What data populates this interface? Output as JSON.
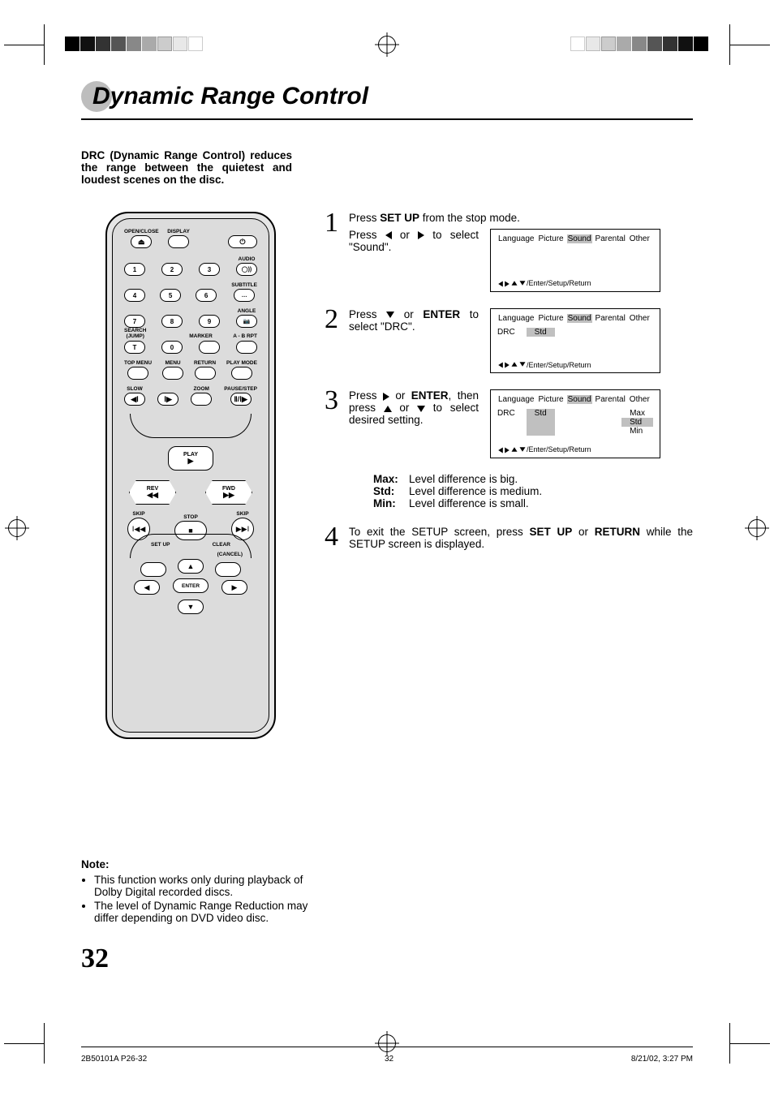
{
  "title": "Dynamic Range Control",
  "intro": "DRC (Dynamic Range Control) reduces the range between the quietest and loudest scenes on the disc.",
  "steps": {
    "s1": {
      "line1_pre": "Press ",
      "line1_bold": "SET UP",
      "line1_post": " from the stop mode.",
      "line2": "Press ◀ or ▶ to select \"Sound\"."
    },
    "s2": {
      "text_pre": "Press ▼ or ",
      "text_bold": "ENTER",
      "text_post": " to select \"DRC\"."
    },
    "s3": {
      "text_pre": "Press ▶ or ",
      "text_bold": "ENTER",
      "text_post": ", then press ▲ or ▼ to select desired setting."
    },
    "s4": {
      "text_pre": "To exit the SETUP screen, press ",
      "b1": "SET UP",
      "mid": " or ",
      "b2": "RETURN",
      "text_post": " while the SETUP screen is displayed."
    }
  },
  "osd": {
    "tabs": [
      "Language",
      "Picture",
      "Sound",
      "Parental",
      "Other"
    ],
    "active_tab": "Sound",
    "drc_label": "DRC",
    "std": "Std",
    "options": [
      "Max",
      "Std",
      "Min"
    ],
    "footer": "/Enter/Setup/Return"
  },
  "definitions": [
    {
      "k": "Max:",
      "v": "Level difference is big."
    },
    {
      "k": "Std:",
      "v": "Level difference is medium."
    },
    {
      "k": "Min:",
      "v": "Level difference is small."
    }
  ],
  "note": {
    "heading": "Note:",
    "items": [
      "This function works only during playback of Dolby Digital recorded discs.",
      "The level of Dynamic Range Reduction may differ depending on DVD video disc."
    ]
  },
  "page_number": "32",
  "footer": {
    "left": "2B50101A P26-32",
    "center": "32",
    "right": "8/21/02, 3:27 PM"
  },
  "remote": {
    "row1": [
      "OPEN/CLOSE",
      "DISPLAY",
      "",
      ""
    ],
    "audio": "AUDIO",
    "subtitle": "SUBTITLE",
    "angle": "ANGLE",
    "searchjump": "SEARCH\n(JUMP)",
    "marker": "MARKER",
    "abrpt": "A - B RPT",
    "t": "T",
    "nums": [
      "1",
      "2",
      "3",
      "4",
      "5",
      "6",
      "7",
      "8",
      "9",
      "0"
    ],
    "row_menu": [
      "TOP MENU",
      "MENU",
      "RETURN",
      "PLAY MODE"
    ],
    "row_slow": [
      "SLOW",
      "",
      "ZOOM",
      "PAUSE/STEP"
    ],
    "play": "PLAY",
    "rev": "REV",
    "fwd": "FWD",
    "skip": "SKIP",
    "stop": "STOP",
    "setup": "SET UP",
    "clear": "CLEAR",
    "cancel": "(CANCEL)",
    "enter": "ENTER"
  }
}
